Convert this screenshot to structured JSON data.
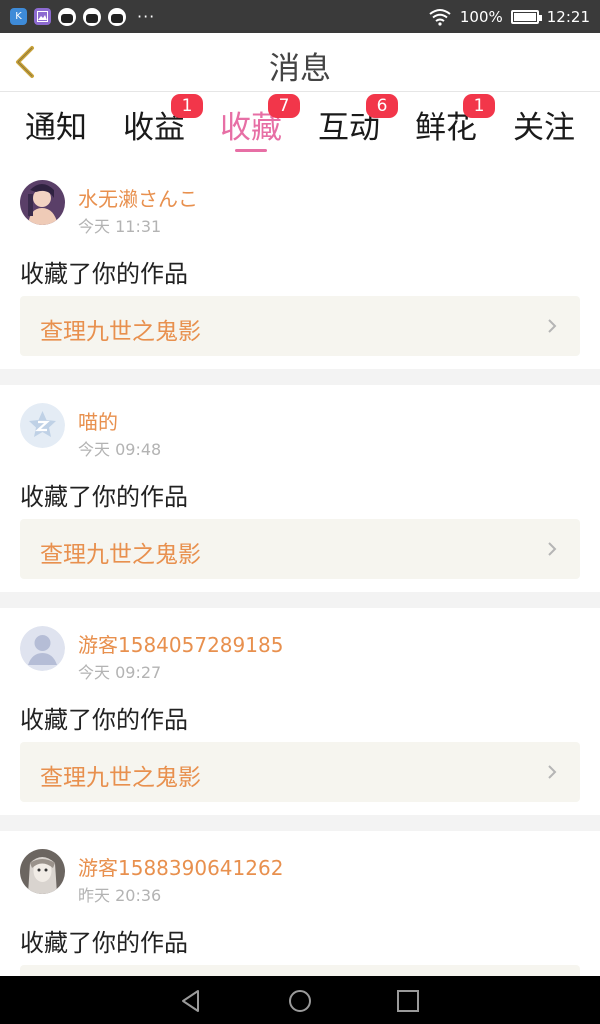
{
  "status_bar": {
    "battery_text": "100%",
    "time": "12:21",
    "more": "···",
    "k_icon_label": "K"
  },
  "header": {
    "title": "消息"
  },
  "tabs": [
    {
      "label": "通知",
      "badge": ""
    },
    {
      "label": "收益",
      "badge": "1"
    },
    {
      "label": "收藏",
      "badge": "7",
      "active": true
    },
    {
      "label": "互动",
      "badge": "6"
    },
    {
      "label": "鲜花",
      "badge": "1"
    },
    {
      "label": "关注",
      "badge": ""
    }
  ],
  "feed": [
    {
      "username": "水无濑さんこ",
      "time": "今天 11:31",
      "action": "收藏了你的作品",
      "work": "查理九世之鬼影",
      "avatar": "anime-girl-avatar"
    },
    {
      "username": "喵的",
      "time": "今天 09:48",
      "action": "收藏了你的作品",
      "work": "查理九世之鬼影",
      "avatar": "default-z-avatar"
    },
    {
      "username": "游客1584057289185",
      "time": "今天 09:27",
      "action": "收藏了你的作品",
      "work": "查理九世之鬼影",
      "avatar": "default-person-avatar"
    },
    {
      "username": "游客1588390641262",
      "time": "昨天 20:36",
      "action": "收藏了你的作品",
      "work": "",
      "avatar": "sketch-girl-avatar"
    }
  ],
  "colors": {
    "accent_pink": "#e76fa5",
    "username_orange": "#e8904e",
    "badge_red": "#f2364a",
    "back_arrow": "#c9a33a"
  }
}
